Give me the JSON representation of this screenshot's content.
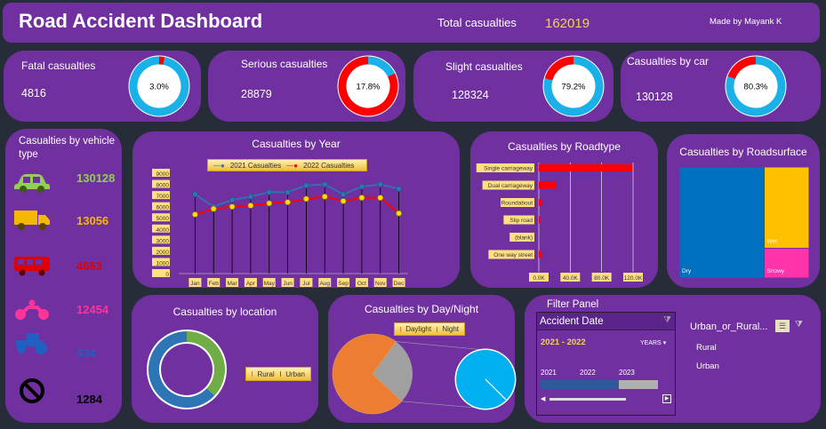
{
  "header": {
    "title": "Road Accident Dashboard",
    "total_label": "Total casualties",
    "total_value": "162019",
    "author": "Made by Mayank K"
  },
  "kpis": [
    {
      "label": "Fatal casualties",
      "value": "4816",
      "pct": "3.0%",
      "pct_num": 3.0,
      "color": "#ff0000",
      "rest": "#1ab0e8"
    },
    {
      "label": "Serious casualties",
      "value": "28879",
      "pct": "17.8%",
      "pct_num": 17.8,
      "color": "#1ab0e8",
      "rest": "#ff0000"
    },
    {
      "label": "Slight casualties",
      "value": "128324",
      "pct": "79.2%",
      "pct_num": 79.2,
      "color": "#1ab0e8",
      "rest": "#ff0000"
    },
    {
      "label": "Casualties by car",
      "value": "130128",
      "pct": "80.3%",
      "pct_num": 80.3,
      "color": "#1ab0e8",
      "rest": "#ff0000"
    }
  ],
  "vehicles": {
    "title": "Casualties by vehicle type",
    "rows": [
      {
        "icon": "car-icon",
        "value": "130128",
        "color": "#92d050"
      },
      {
        "icon": "truck-icon",
        "value": "13056",
        "color": "#f5b800"
      },
      {
        "icon": "bus-icon",
        "value": "4663",
        "color": "#e00000"
      },
      {
        "icon": "motorcycle-icon",
        "value": "12454",
        "color": "#ff3399"
      },
      {
        "icon": "tractor-icon",
        "value": "634",
        "color": "#1f60c0"
      },
      {
        "icon": "no-entry-icon",
        "value": "1284",
        "color": "#000000"
      }
    ]
  },
  "year_chart": {
    "title": "Casualties by Year",
    "legend": [
      "2021 Casualties",
      "2022 Casualties"
    ]
  },
  "roadtype_chart": {
    "title": "Casualties by Roadtype"
  },
  "surface_chart": {
    "title": "Casualties by Roadsurface"
  },
  "location_chart": {
    "title": "Casualties by location",
    "legend": [
      "Rural",
      "Urban"
    ]
  },
  "daynight_chart": {
    "title": "Casualties by Day/Night",
    "legend": [
      "Daylight",
      "Night"
    ]
  },
  "filter": {
    "panel_title": "Filter Panel",
    "date_label": "Accident Date",
    "range": "2021 - 2022",
    "unit": "YEARS",
    "years": [
      "2021",
      "2022",
      "2023"
    ],
    "slicer_label": "Urban_or_Rural...",
    "slicer_items": [
      "Rural",
      "Urban"
    ]
  },
  "chart_data": [
    {
      "type": "line",
      "title": "Casualties by Year",
      "categories": [
        "Jan",
        "Feb",
        "Mar",
        "Apr",
        "May",
        "Jun",
        "Jul",
        "Aug",
        "Sep",
        "Oct",
        "Nov",
        "Dec"
      ],
      "yticks": [
        "0",
        "1000",
        "2000",
        "3000",
        "4000",
        "5000",
        "6000",
        "7000",
        "8000",
        "9000"
      ],
      "ylim": [
        0,
        9000
      ],
      "series": [
        {
          "name": "2021 Casualties",
          "color": "#2e75b6",
          "values": [
            7100,
            6000,
            6600,
            6900,
            7300,
            7300,
            7900,
            8000,
            7100,
            7800,
            8000,
            7600
          ]
        },
        {
          "name": "2022 Casualties",
          "color": "#ff0000",
          "values": [
            5300,
            5800,
            6000,
            6100,
            6300,
            6400,
            6700,
            6900,
            6500,
            6800,
            6800,
            5400
          ]
        }
      ],
      "legend": "top"
    },
    {
      "type": "bar",
      "title": "Casualties by Roadtype",
      "categories": [
        "Single carriageway",
        "Dual carriageway",
        "Roundabout",
        "Slip road",
        "(blank)",
        "One way street"
      ],
      "values": [
        119000,
        22000,
        4000,
        1000,
        0,
        3000
      ],
      "xticks": [
        "0.0K",
        "40.0K",
        "80.0K",
        "120.0K"
      ],
      "xlim": [
        0,
        120000
      ],
      "color": "#ff0000"
    },
    {
      "type": "heatmap",
      "title": "Casualties by Roadsurface",
      "categories": [
        "Dry",
        "Wet",
        "Snowy"
      ],
      "values": [
        106000,
        41000,
        15000
      ],
      "colors": [
        "#0070c0",
        "#ffc000",
        "#ff33aa"
      ]
    },
    {
      "type": "pie",
      "title": "Casualties by location",
      "categories": [
        "Rural",
        "Urban"
      ],
      "values": [
        37,
        63
      ],
      "colors": [
        "#70ad47",
        "#2e75b6"
      ]
    },
    {
      "type": "pie",
      "title": "Casualties by Day/Night",
      "categories": [
        "Daylight",
        "Night"
      ],
      "values": [
        73,
        27
      ],
      "colors": [
        "#ed7d31",
        "#00b0f0"
      ]
    }
  ]
}
